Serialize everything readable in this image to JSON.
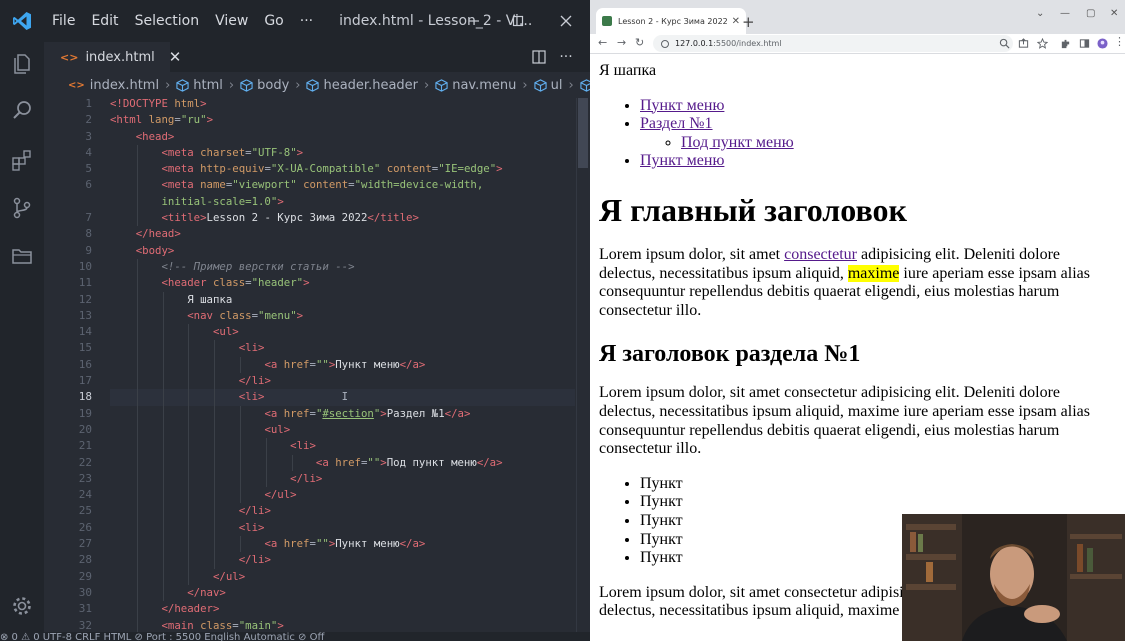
{
  "vscode": {
    "menu": [
      "File",
      "Edit",
      "Selection",
      "View",
      "Go"
    ],
    "menu_more": "···",
    "window_title": "index.html - Lesson_2 - Vi...",
    "tab": {
      "label": "index.html",
      "close": "✕"
    },
    "breadcrumb": [
      "index.html",
      "html",
      "body",
      "header.header",
      "nav.menu",
      "ul",
      "li"
    ],
    "current_line": 18,
    "line_numbers": [
      "1",
      "2",
      "3",
      "4",
      "5",
      "6",
      "",
      "7",
      "8",
      "9",
      "10",
      "11",
      "12",
      "13",
      "14",
      "15",
      "16",
      "17",
      "18",
      "19",
      "20",
      "21",
      "22",
      "23",
      "24",
      "25",
      "26",
      "27",
      "28",
      "29",
      "30",
      "31",
      "32"
    ],
    "status": "⊗ 0 ⚠ 0    UTF-8   CRLF   HTML   ⊘ Port : 5500   English   Automatic   ⊘ Off"
  },
  "browser": {
    "tab_title": "Lesson 2 - Курс Зима 2022",
    "tab_close": "✕",
    "new_tab": "+",
    "url_host": "127.0.0.1",
    "url_path": ":5500/index.html"
  },
  "page": {
    "header_text": "Я шапка",
    "menu": {
      "item1": "Пункт меню",
      "item2": "Раздел №1",
      "subitem": "Под пункт меню",
      "item3": "Пункт меню"
    },
    "h1": "Я главный заголовок",
    "p1": {
      "before": "Lorem ipsum dolor, sit amet ",
      "link": "consectetur",
      "middle": " adipisicing elit. Deleniti dolore delectus, necessitatibus ipsum aliquid, ",
      "highlight": "maxime",
      "after": " iure aperiam esse ipsam alias consequuntur repellendus debitis quaerat eligendi, eius molestias harum consectetur illo."
    },
    "h2": "Я заголовок раздела №1",
    "p2": "Lorem ipsum dolor, sit amet consectetur adipisicing elit. Deleniti dolore delectus, necessitatibus ipsum aliquid, maxime iure aperiam esse ipsam alias consequuntur repellendus debitis quaerat eligendi, eius molestias harum consectetur illo.",
    "list": [
      "Пункт",
      "Пункт",
      "Пункт",
      "Пункт",
      "Пункт"
    ],
    "p3": "Lorem ipsum dolor, sit amet consectetur adipisicing elit. Deleniti dolore delectus, necessitatibus ipsum aliquid, maxime iure aperiam esse ipsam alias"
  }
}
